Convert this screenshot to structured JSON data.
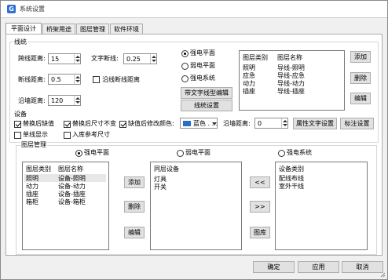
{
  "window": {
    "title": "系统设置"
  },
  "tabs": [
    {
      "label": "平面设计",
      "active": true
    },
    {
      "label": "桥架用途",
      "active": false
    },
    {
      "label": "图层管理",
      "active": false
    },
    {
      "label": "软件环境",
      "active": false
    }
  ],
  "lines": {
    "section_label": "线统",
    "jump_distance_label": "跨线距离:",
    "jump_distance_value": "15",
    "break_distance_label": "断线距离:",
    "break_distance_value": "0.5",
    "wall_distance_label": "沿墙距离:",
    "wall_distance_value": "120",
    "text_break_label": "文字断线:",
    "text_break_value": "0.25",
    "along_break_label": "沿线断线距离",
    "along_break_checked": false,
    "radios": [
      {
        "label": "强电平面",
        "checked": true
      },
      {
        "label": "弱电平面",
        "checked": false
      },
      {
        "label": "强电系统",
        "checked": false
      }
    ],
    "text_line_btn": "带文字线型编辑",
    "line_settings_btn": "线统设置",
    "table_headers": [
      "图层类别",
      "图层名称"
    ],
    "table_rows": [
      [
        "照明",
        "导线-照明"
      ],
      [
        "应急",
        "导线-应急"
      ],
      [
        "动力",
        "导线-动力"
      ],
      [
        "插座",
        "导线-插座"
      ]
    ],
    "add_btn": "添加",
    "delete_btn": "删除",
    "edit_btn": "编辑"
  },
  "device": {
    "section_label": "设备",
    "replace_block": {
      "label": "替换后缺值",
      "checked": true
    },
    "replace_size": {
      "label": "替换后尺寸不变",
      "checked": true
    },
    "change_color": {
      "label": "缺值后修改颜色:",
      "checked": true
    },
    "color_value": "蓝色 . . .",
    "color_hex": "#2a6fc3",
    "wall_distance_label": "沿墙距离:",
    "wall_distance_value": "0",
    "attr_text_btn": "属性文字设置",
    "label_settings_btn": "标注设置",
    "single_line": {
      "label": "单线显示",
      "checked": false
    },
    "ref_size": {
      "label": "入库参考尺寸",
      "checked": false
    },
    "layer_mgmt_label": "图层管理",
    "radios": [
      {
        "label": "强电平面",
        "checked": true
      },
      {
        "label": "弱电平面",
        "checked": false
      },
      {
        "label": "强电系统",
        "checked": false
      }
    ],
    "left_list_headers": [
      "图层类别",
      "图层名称"
    ],
    "left_list_rows": [
      [
        "照明",
        "设备-照明"
      ],
      [
        "动力",
        "设备-动力"
      ],
      [
        "插座",
        "设备-插座"
      ],
      [
        "箱柜",
        "设备-箱柜"
      ]
    ],
    "add_btn": "添加",
    "delete_btn": "删除",
    "edit_btn": "编辑",
    "mid_list_header": "同层设备",
    "mid_list_rows": [
      "灯具",
      "开关"
    ],
    "move_left_btn": "<<",
    "move_right_btn": ">>",
    "library_btn": "图库",
    "right_list_header": "设备类别",
    "right_list_rows": [
      "配线布线",
      "室外干线"
    ]
  },
  "footer": {
    "ok_btn": "确定",
    "apply_btn": "应用",
    "cancel_btn": "取消"
  }
}
